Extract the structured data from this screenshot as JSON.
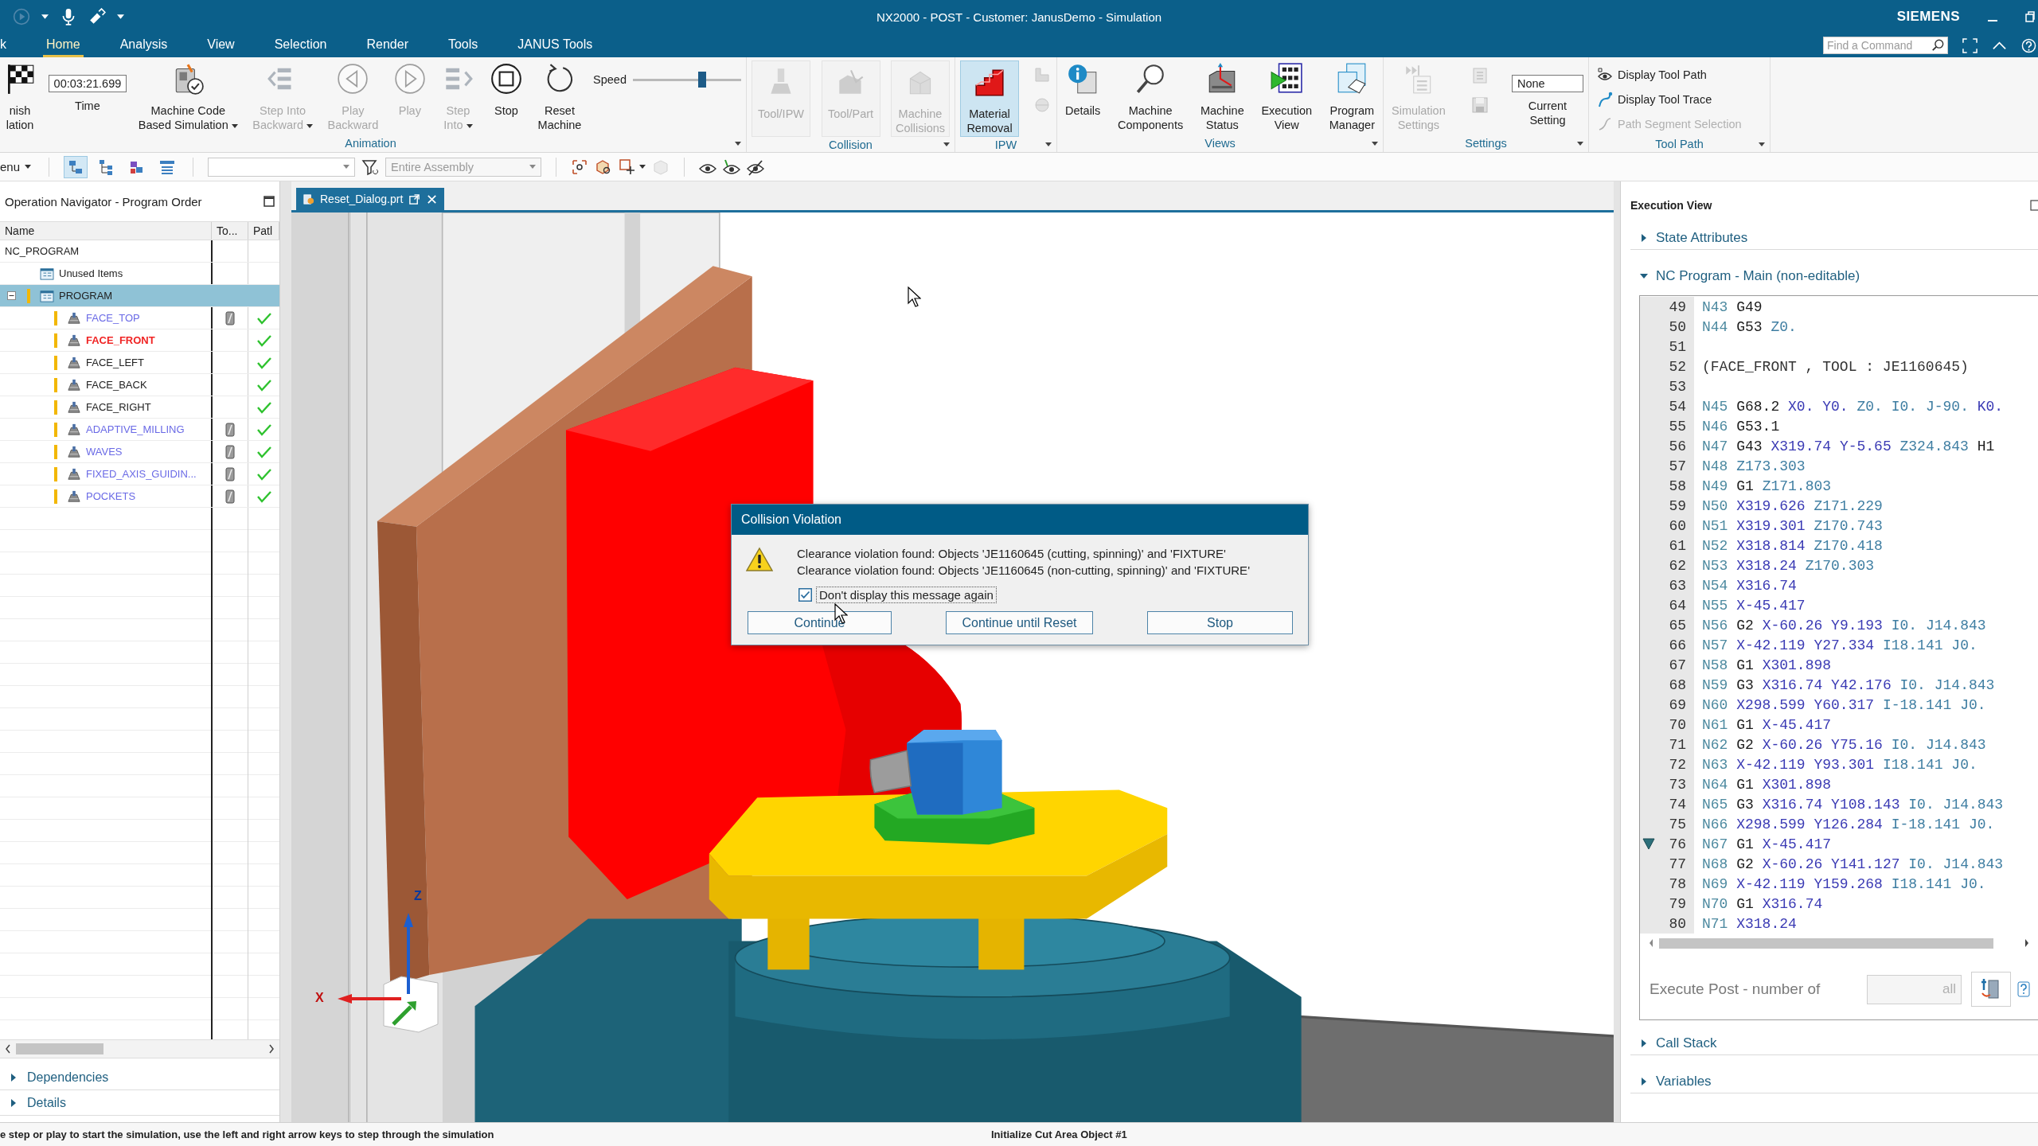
{
  "title_bar": {
    "title": "NX2000 - POST - Customer: JanusDemo - Simulation",
    "brand": "SIEMENS"
  },
  "tabs": [
    {
      "label": "k",
      "selected": false
    },
    {
      "label": "Home",
      "selected": true
    },
    {
      "label": "Analysis",
      "selected": false
    },
    {
      "label": "View",
      "selected": false
    },
    {
      "label": "Selection",
      "selected": false
    },
    {
      "label": "Render",
      "selected": false
    },
    {
      "label": "Tools",
      "selected": false
    },
    {
      "label": "JANUS Tools",
      "selected": false
    }
  ],
  "command_search": {
    "placeholder": "Find a Command"
  },
  "ribbon": {
    "groups": [
      {
        "label": "Animation",
        "items": [
          {
            "kind": "button",
            "label": "nish\nlation",
            "disabled": false,
            "dropdown": false
          },
          {
            "kind": "field",
            "value": "00:03:21.699",
            "label": "Time"
          },
          {
            "kind": "button",
            "label": "Machine Code\nBased Simulation",
            "disabled": false,
            "dropdown": true
          },
          {
            "kind": "button",
            "label": "Step Into\nBackward",
            "disabled": true,
            "dropdown": true
          },
          {
            "kind": "button",
            "label": "Play\nBackward",
            "disabled": true,
            "dropdown": false
          },
          {
            "kind": "button",
            "label": "Play",
            "disabled": true,
            "dropdown": false
          },
          {
            "kind": "button",
            "label": "Step\nInto",
            "disabled": true,
            "dropdown": true
          },
          {
            "kind": "button",
            "label": "Stop",
            "disabled": false,
            "dropdown": false
          },
          {
            "kind": "button",
            "label": "Reset\nMachine",
            "disabled": false,
            "dropdown": false
          },
          {
            "kind": "slider",
            "label": "Speed",
            "level": 0.65
          }
        ]
      },
      {
        "label": "Collision",
        "items": [
          {
            "kind": "toggle",
            "label": "Tool/IPW",
            "disabled": true,
            "on": false
          },
          {
            "kind": "toggle",
            "label": "Tool/Part",
            "disabled": true,
            "on": false
          },
          {
            "kind": "toggle",
            "label": "Machine\nCollisions",
            "disabled": true,
            "on": false
          }
        ]
      },
      {
        "label": "IPW",
        "items": [
          {
            "kind": "toggle",
            "label": "Material\nRemoval",
            "disabled": false,
            "on": true
          },
          {
            "kind": "stack",
            "disabled": true
          }
        ]
      },
      {
        "label": "Views",
        "items": [
          {
            "kind": "button",
            "label": "Details",
            "disabled": false,
            "dropdown": false
          },
          {
            "kind": "button",
            "label": "Machine\nComponents",
            "disabled": false,
            "dropdown": false
          },
          {
            "kind": "button",
            "label": "Machine\nStatus",
            "disabled": false,
            "dropdown": false
          },
          {
            "kind": "button",
            "label": "Execution\nView",
            "disabled": false,
            "dropdown": false
          },
          {
            "kind": "button",
            "label": "Program\nManager",
            "disabled": false,
            "dropdown": false
          }
        ]
      },
      {
        "label": "Settings",
        "items": [
          {
            "kind": "button",
            "label": "Simulation\nSettings",
            "disabled": true,
            "dropdown": false
          },
          {
            "kind": "stack",
            "disabled": true
          },
          {
            "kind": "field",
            "value": "None",
            "label": "Current\nSetting"
          }
        ]
      },
      {
        "label": "Tool Path",
        "items": [
          {
            "kind": "row",
            "label": "Display Tool Path",
            "disabled": false
          },
          {
            "kind": "row",
            "label": "Display Tool Trace",
            "disabled": false
          },
          {
            "kind": "row",
            "label": "Path Segment Selection",
            "disabled": true
          }
        ]
      }
    ]
  },
  "toolbar": {
    "menu_label": "enu",
    "view_buttons": [
      {
        "selected": true
      },
      {
        "selected": false
      },
      {
        "selected": false
      },
      {
        "selected": false
      }
    ],
    "scope": {
      "value": "Entire Assembly",
      "disabled": true
    }
  },
  "navigator": {
    "title": "Operation Navigator - Program Order",
    "columns": [
      "Name",
      "To...",
      "Patl"
    ],
    "tree": [
      {
        "name": "NC_PROGRAM",
        "selected": false,
        "children": [
          {
            "name": "Unused Items",
            "kind": "group",
            "selected": false,
            "flagged": false
          },
          {
            "name": "PROGRAM",
            "kind": "group",
            "selected": true,
            "flagged": true,
            "expanded": true,
            "children": [
              {
                "name": "FACE_TOP",
                "kind": "operation",
                "selected": false,
                "flagged": true,
                "color": "#6a6ae6",
                "current": false,
                "tool_mark": true,
                "path_done": true
              },
              {
                "name": "FACE_FRONT",
                "kind": "operation",
                "selected": false,
                "flagged": true,
                "color": "#f02424",
                "current": true,
                "tool_mark": false,
                "path_done": true
              },
              {
                "name": "FACE_LEFT",
                "kind": "operation",
                "selected": false,
                "flagged": true,
                "color": "#222222",
                "current": false,
                "tool_mark": false,
                "path_done": true
              },
              {
                "name": "FACE_BACK",
                "kind": "operation",
                "selected": false,
                "flagged": true,
                "color": "#222222",
                "current": false,
                "tool_mark": false,
                "path_done": true
              },
              {
                "name": "FACE_RIGHT",
                "kind": "operation",
                "selected": false,
                "flagged": true,
                "color": "#222222",
                "current": false,
                "tool_mark": false,
                "path_done": true
              },
              {
                "name": "ADAPTIVE_MILLING",
                "kind": "operation",
                "selected": false,
                "flagged": true,
                "color": "#6a6ae6",
                "current": false,
                "tool_mark": true,
                "path_done": true
              },
              {
                "name": "WAVES",
                "kind": "operation",
                "selected": false,
                "flagged": true,
                "color": "#6a6ae6",
                "current": false,
                "tool_mark": true,
                "path_done": true
              },
              {
                "name": "FIXED_AXIS_GUIDIN...",
                "kind": "operation",
                "selected": false,
                "flagged": true,
                "color": "#6a6ae6",
                "current": false,
                "tool_mark": true,
                "path_done": true
              },
              {
                "name": "POCKETS",
                "kind": "operation",
                "selected": false,
                "flagged": true,
                "color": "#6a6ae6",
                "current": false,
                "tool_mark": true,
                "path_done": true
              }
            ]
          }
        ]
      }
    ],
    "sections": [
      {
        "label": "Dependencies",
        "expanded": false
      },
      {
        "label": "Details",
        "expanded": false
      }
    ]
  },
  "viewport": {
    "tab": {
      "label": "Reset_Dialog.prt",
      "selected": true
    },
    "triad": {
      "z_label": "Z",
      "x_label": "X"
    },
    "dialog": {
      "title": "Collision Violation",
      "messages": [
        "Clearance violation found: Objects 'JE1160645 (cutting, spinning)' and 'FIXTURE'",
        "Clearance violation found: Objects 'JE1160645 (non-cutting, spinning)' and 'FIXTURE'"
      ],
      "checkbox": {
        "label": "Don't display this message again",
        "checked": true
      },
      "buttons": [
        "Continue",
        "Continue until Reset",
        "Stop"
      ]
    }
  },
  "execution_view": {
    "title": "Execution View",
    "sections": [
      {
        "label": "State Attributes",
        "expanded": false
      }
    ],
    "nc_program": {
      "label": "NC Program - Main (non-editable)",
      "expanded": true,
      "lines": [
        {
          "number": "49",
          "current": false,
          "tokens": [
            {
              "text": "N43",
              "kind": "block"
            },
            {
              "text": "G49",
              "kind": "cmd"
            }
          ]
        },
        {
          "number": "50",
          "current": false,
          "tokens": [
            {
              "text": "N44",
              "kind": "block"
            },
            {
              "text": "G53",
              "kind": "cmd"
            },
            {
              "text": "Z0.",
              "kind": "param"
            }
          ]
        },
        {
          "number": "51",
          "current": false
        },
        {
          "number": "52",
          "current": false,
          "tokens": [
            {
              "text": "(FACE_FRONT , TOOL : JE1160645)",
              "kind": "comment"
            }
          ]
        },
        {
          "number": "53",
          "current": false
        },
        {
          "number": "54",
          "current": false,
          "tokens": [
            {
              "text": "N45",
              "kind": "block"
            },
            {
              "text": "G68.2",
              "kind": "cmd"
            },
            {
              "text": "X0.",
              "kind": "coord"
            },
            {
              "text": "Y0.",
              "kind": "coord"
            },
            {
              "text": "Z0.",
              "kind": "param"
            },
            {
              "text": "I0.",
              "kind": "param"
            },
            {
              "text": "J-90.",
              "kind": "param"
            },
            {
              "text": "K0.",
              "kind": "coord"
            }
          ]
        },
        {
          "number": "55",
          "current": false,
          "tokens": [
            {
              "text": "N46",
              "kind": "block"
            },
            {
              "text": "G53.1",
              "kind": "cmd"
            }
          ]
        },
        {
          "number": "56",
          "current": false,
          "tokens": [
            {
              "text": "N47",
              "kind": "block"
            },
            {
              "text": "G43",
              "kind": "cmd"
            },
            {
              "text": "X319.74",
              "kind": "coord"
            },
            {
              "text": "Y-5.65",
              "kind": "coord"
            },
            {
              "text": "Z324.843",
              "kind": "param"
            },
            {
              "text": "H1",
              "kind": "cmd"
            }
          ]
        },
        {
          "number": "57",
          "current": false,
          "tokens": [
            {
              "text": "N48",
              "kind": "block"
            },
            {
              "text": "Z173.303",
              "kind": "param"
            }
          ]
        },
        {
          "number": "58",
          "current": false,
          "tokens": [
            {
              "text": "N49",
              "kind": "block"
            },
            {
              "text": "G1",
              "kind": "cmd"
            },
            {
              "text": "Z171.803",
              "kind": "param"
            }
          ]
        },
        {
          "number": "59",
          "current": false,
          "tokens": [
            {
              "text": "N50",
              "kind": "block"
            },
            {
              "text": "X319.626",
              "kind": "coord"
            },
            {
              "text": "Z171.229",
              "kind": "param"
            }
          ]
        },
        {
          "number": "60",
          "current": false,
          "tokens": [
            {
              "text": "N51",
              "kind": "block"
            },
            {
              "text": "X319.301",
              "kind": "coord"
            },
            {
              "text": "Z170.743",
              "kind": "param"
            }
          ]
        },
        {
          "number": "61",
          "current": false,
          "tokens": [
            {
              "text": "N52",
              "kind": "block"
            },
            {
              "text": "X318.814",
              "kind": "coord"
            },
            {
              "text": "Z170.418",
              "kind": "param"
            }
          ]
        },
        {
          "number": "62",
          "current": false,
          "tokens": [
            {
              "text": "N53",
              "kind": "block"
            },
            {
              "text": "X318.24",
              "kind": "coord"
            },
            {
              "text": "Z170.303",
              "kind": "param"
            }
          ]
        },
        {
          "number": "63",
          "current": false,
          "tokens": [
            {
              "text": "N54",
              "kind": "block"
            },
            {
              "text": "X316.74",
              "kind": "coord"
            }
          ]
        },
        {
          "number": "64",
          "current": false,
          "tokens": [
            {
              "text": "N55",
              "kind": "block"
            },
            {
              "text": "X-45.417",
              "kind": "coord"
            }
          ]
        },
        {
          "number": "65",
          "current": false,
          "tokens": [
            {
              "text": "N56",
              "kind": "block"
            },
            {
              "text": "G2",
              "kind": "cmd"
            },
            {
              "text": "X-60.26",
              "kind": "coord"
            },
            {
              "text": "Y9.193",
              "kind": "coord"
            },
            {
              "text": "I0.",
              "kind": "param"
            },
            {
              "text": "J14.843",
              "kind": "param"
            }
          ]
        },
        {
          "number": "66",
          "current": false,
          "tokens": [
            {
              "text": "N57",
              "kind": "block"
            },
            {
              "text": "X-42.119",
              "kind": "coord"
            },
            {
              "text": "Y27.334",
              "kind": "coord"
            },
            {
              "text": "I18.141",
              "kind": "param"
            },
            {
              "text": "J0.",
              "kind": "param"
            }
          ]
        },
        {
          "number": "67",
          "current": false,
          "tokens": [
            {
              "text": "N58",
              "kind": "block"
            },
            {
              "text": "G1",
              "kind": "cmd"
            },
            {
              "text": "X301.898",
              "kind": "coord"
            }
          ]
        },
        {
          "number": "68",
          "current": false,
          "tokens": [
            {
              "text": "N59",
              "kind": "block"
            },
            {
              "text": "G3",
              "kind": "cmd"
            },
            {
              "text": "X316.74",
              "kind": "coord"
            },
            {
              "text": "Y42.176",
              "kind": "coord"
            },
            {
              "text": "I0.",
              "kind": "param"
            },
            {
              "text": "J14.843",
              "kind": "param"
            }
          ]
        },
        {
          "number": "69",
          "current": false,
          "tokens": [
            {
              "text": "N60",
              "kind": "block"
            },
            {
              "text": "X298.599",
              "kind": "coord"
            },
            {
              "text": "Y60.317",
              "kind": "coord"
            },
            {
              "text": "I-18.141",
              "kind": "param"
            },
            {
              "text": "J0.",
              "kind": "param"
            }
          ]
        },
        {
          "number": "70",
          "current": false,
          "tokens": [
            {
              "text": "N61",
              "kind": "block"
            },
            {
              "text": "G1",
              "kind": "cmd"
            },
            {
              "text": "X-45.417",
              "kind": "coord"
            }
          ]
        },
        {
          "number": "71",
          "current": false,
          "tokens": [
            {
              "text": "N62",
              "kind": "block"
            },
            {
              "text": "G2",
              "kind": "cmd"
            },
            {
              "text": "X-60.26",
              "kind": "coord"
            },
            {
              "text": "Y75.16",
              "kind": "coord"
            },
            {
              "text": "I0.",
              "kind": "param"
            },
            {
              "text": "J14.843",
              "kind": "param"
            }
          ]
        },
        {
          "number": "72",
          "current": false,
          "tokens": [
            {
              "text": "N63",
              "kind": "block"
            },
            {
              "text": "X-42.119",
              "kind": "coord"
            },
            {
              "text": "Y93.301",
              "kind": "coord"
            },
            {
              "text": "I18.141",
              "kind": "param"
            },
            {
              "text": "J0.",
              "kind": "param"
            }
          ]
        },
        {
          "number": "73",
          "current": false,
          "tokens": [
            {
              "text": "N64",
              "kind": "block"
            },
            {
              "text": "G1",
              "kind": "cmd"
            },
            {
              "text": "X301.898",
              "kind": "coord"
            }
          ]
        },
        {
          "number": "74",
          "current": false,
          "tokens": [
            {
              "text": "N65",
              "kind": "block"
            },
            {
              "text": "G3",
              "kind": "cmd"
            },
            {
              "text": "X316.74",
              "kind": "coord"
            },
            {
              "text": "Y108.143",
              "kind": "coord"
            },
            {
              "text": "I0.",
              "kind": "param"
            },
            {
              "text": "J14.843",
              "kind": "param"
            }
          ]
        },
        {
          "number": "75",
          "current": false,
          "tokens": [
            {
              "text": "N66",
              "kind": "block"
            },
            {
              "text": "X298.599",
              "kind": "coord"
            },
            {
              "text": "Y126.284",
              "kind": "coord"
            },
            {
              "text": "I-18.141",
              "kind": "param"
            },
            {
              "text": "J0.",
              "kind": "param"
            }
          ]
        },
        {
          "number": "76",
          "current": true,
          "tokens": [
            {
              "text": "N67",
              "kind": "block"
            },
            {
              "text": "G1",
              "kind": "cmd"
            },
            {
              "text": "X-45.417",
              "kind": "coord"
            }
          ]
        },
        {
          "number": "77",
          "current": false,
          "tokens": [
            {
              "text": "N68",
              "kind": "block"
            },
            {
              "text": "G2",
              "kind": "cmd"
            },
            {
              "text": "X-60.26",
              "kind": "coord"
            },
            {
              "text": "Y141.127",
              "kind": "coord"
            },
            {
              "text": "I0.",
              "kind": "param"
            },
            {
              "text": "J14.843",
              "kind": "param"
            }
          ]
        },
        {
          "number": "78",
          "current": false,
          "tokens": [
            {
              "text": "N69",
              "kind": "block"
            },
            {
              "text": "X-42.119",
              "kind": "coord"
            },
            {
              "text": "Y159.268",
              "kind": "coord"
            },
            {
              "text": "I18.141",
              "kind": "param"
            },
            {
              "text": "J0.",
              "kind": "param"
            }
          ]
        },
        {
          "number": "79",
          "current": false,
          "tokens": [
            {
              "text": "N70",
              "kind": "block"
            },
            {
              "text": "G1",
              "kind": "cmd"
            },
            {
              "text": "X316.74",
              "kind": "coord"
            }
          ]
        },
        {
          "number": "80",
          "current": false,
          "tokens": [
            {
              "text": "N71",
              "kind": "block"
            },
            {
              "text": "X318.24",
              "kind": "coord"
            }
          ]
        }
      ]
    },
    "execute_post": {
      "label": "Execute Post - number of",
      "placeholder": "all"
    },
    "bottom_sections": [
      {
        "label": "Call Stack",
        "expanded": false
      },
      {
        "label": "Variables",
        "expanded": false
      }
    ]
  },
  "status_bar": {
    "prompt": "e step or play to start the simulation, use the left and right arrow keys to step through the simulation",
    "message": "Initialize Cut Area Object #1"
  }
}
